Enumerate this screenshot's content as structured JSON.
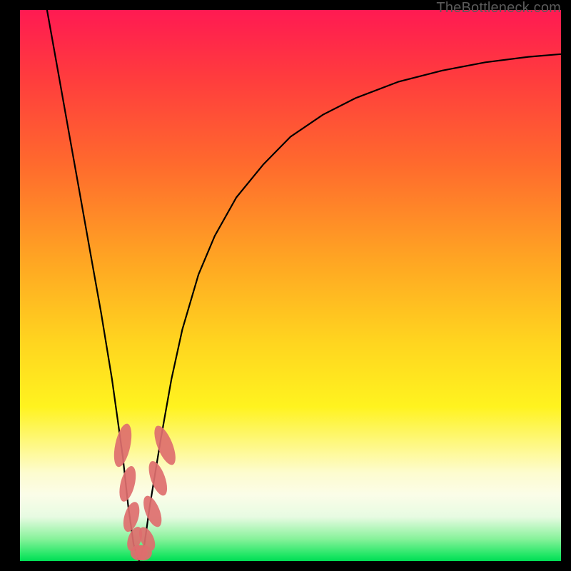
{
  "watermark": {
    "text": "TheBottleneck.com"
  },
  "colors": {
    "curve": "#000000",
    "marker_fill": "#de6e6e",
    "marker_stroke": "#c95454",
    "frame": "#000000"
  },
  "chart_data": {
    "type": "line",
    "title": "",
    "xlabel": "",
    "ylabel": "",
    "xlim": [
      0,
      100
    ],
    "ylim": [
      0,
      100
    ],
    "grid": false,
    "legend": false,
    "series": [
      {
        "name": "bottleneck-curve",
        "x": [
          5,
          7,
          9,
          11,
          13,
          15,
          17,
          19,
          20,
          21,
          22,
          23,
          24,
          26,
          28,
          30,
          33,
          36,
          40,
          45,
          50,
          56,
          62,
          70,
          78,
          86,
          94,
          100
        ],
        "y": [
          100,
          89,
          78,
          67,
          56,
          45,
          33,
          19,
          10,
          3,
          0,
          3,
          10,
          22,
          33,
          42,
          52,
          59,
          66,
          72,
          77,
          81,
          84,
          87,
          89,
          90.5,
          91.5,
          92
        ]
      }
    ],
    "annotations": {
      "marker_clusters": [
        {
          "cx": 19.0,
          "cy": 21,
          "rx": 1.4,
          "ry": 4.0,
          "rot": 12
        },
        {
          "cx": 19.9,
          "cy": 14,
          "rx": 1.3,
          "ry": 3.3,
          "rot": 14
        },
        {
          "cx": 20.6,
          "cy": 8,
          "rx": 1.3,
          "ry": 2.8,
          "rot": 16
        },
        {
          "cx": 21.2,
          "cy": 4,
          "rx": 1.2,
          "ry": 2.3,
          "rot": 20
        },
        {
          "cx": 22.0,
          "cy": 1.5,
          "rx": 1.6,
          "ry": 1.4,
          "rot": 0
        },
        {
          "cx": 22.8,
          "cy": 1.5,
          "rx": 1.6,
          "ry": 1.4,
          "rot": 0
        },
        {
          "cx": 23.5,
          "cy": 4,
          "rx": 1.2,
          "ry": 2.3,
          "rot": -25
        },
        {
          "cx": 24.5,
          "cy": 9,
          "rx": 1.3,
          "ry": 3.0,
          "rot": -22
        },
        {
          "cx": 25.5,
          "cy": 15,
          "rx": 1.3,
          "ry": 3.3,
          "rot": -20
        },
        {
          "cx": 26.8,
          "cy": 21,
          "rx": 1.4,
          "ry": 3.8,
          "rot": -22
        }
      ]
    }
  }
}
